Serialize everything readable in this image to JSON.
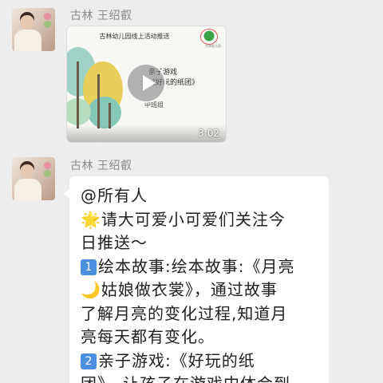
{
  "messages": [
    {
      "sender": "古林  王绍叡",
      "video": {
        "header": "古林幼儿园线上活动推送",
        "logo_text": "古林幼儿园",
        "title_lines": [
          "亲子游戏",
          "《好玩的纸团》"
        ],
        "grade": "中班组",
        "duration": "3:02"
      }
    },
    {
      "sender": "古林  王绍叡",
      "lines": [
        "@所有人",
        "请大可爱小可爱们关注今",
        "日推送～",
        "绘本故事:绘本故事:《月亮",
        "姑娘做衣裳》，通过故事",
        "了解月亮的变化过程,知道月",
        "亮每天都有变化。",
        "亲子游戏:《好玩的纸",
        "团》，让孩子在游戏中体会到"
      ],
      "icons": {
        "star": "🌟",
        "moon": "🌙",
        "key1": "1",
        "key2": "2"
      }
    }
  ],
  "colors": {
    "background": "#ededed",
    "bubble": "#ffffff",
    "keycap": "#4a8fe0"
  }
}
